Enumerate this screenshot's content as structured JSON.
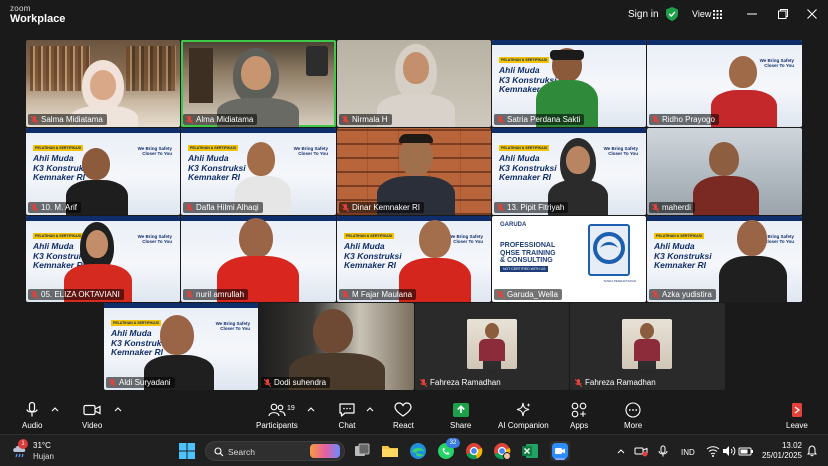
{
  "titlebar": {
    "brand_small": "zoom",
    "brand_large": "Workplace",
    "signin_label": "Sign in",
    "view_label": "View"
  },
  "participants": [
    {
      "name": "Salma Midiatama"
    },
    {
      "name": "Alma Midiatama"
    },
    {
      "name": "Nirmala H"
    },
    {
      "name": "Satria Perdana Sakti"
    },
    {
      "name": "Ridho Prayogo"
    },
    {
      "name": "10. M. Arif"
    },
    {
      "name": "Dafla Hilmi Alhaqi"
    },
    {
      "name": "Dinar Kemnaker RI"
    },
    {
      "name": "13. Pipit Fitriyah"
    },
    {
      "name": "maherdi"
    },
    {
      "name": "05. ELIZA OKTAVIANI"
    },
    {
      "name": "nuril amrullah"
    },
    {
      "name": "M Fajar Maulana"
    },
    {
      "name": "Garuda_Wella"
    },
    {
      "name": "Azka yudistira"
    },
    {
      "name": "Aldi Suryadani"
    },
    {
      "name": "Dodi suhendra"
    },
    {
      "name": "Fahreza Ramadhan"
    },
    {
      "name": "Fahreza Ramadhan"
    }
  ],
  "promo": {
    "tag": "PELATIHAN & SERTIFIKASI",
    "title_line1": "Ahli Muda",
    "title_line2": "K3 Konstruksi",
    "title_line3": "Kemnaker RI",
    "slogan_line1": "We Bring Safety",
    "slogan_line2": "Closer To You",
    "logo": "MASTASOS"
  },
  "garuda_slide": {
    "logo": "GARUDA",
    "heading_line1": "PROFESSIONAL",
    "heading_line2": "QHSE TRAINING",
    "heading_line3": "& CONSULTING",
    "sub": "NOT CERTIFIED WITH US",
    "badge_text": "TANDA PENDAFTARAN"
  },
  "toolbar": {
    "audio": "Audio",
    "video": "Video",
    "participants": "Participants",
    "participants_count": "19",
    "chat": "Chat",
    "react": "React",
    "share": "Share",
    "ai_companion": "AI Companion",
    "apps": "Apps",
    "more": "More",
    "leave": "Leave"
  },
  "taskbar": {
    "weather_temp": "31°C",
    "weather_condition": "Hujan",
    "weather_badge": "1",
    "search_label": "Search",
    "whatsapp_badge": "32",
    "language": "IND",
    "time": "13.02",
    "date": "25/01/2025"
  },
  "colors": {
    "active_speaker": "#3ec94a",
    "share_green": "#1ea04b",
    "leave_red": "#e5413a",
    "muted_red": "#e5413a"
  }
}
